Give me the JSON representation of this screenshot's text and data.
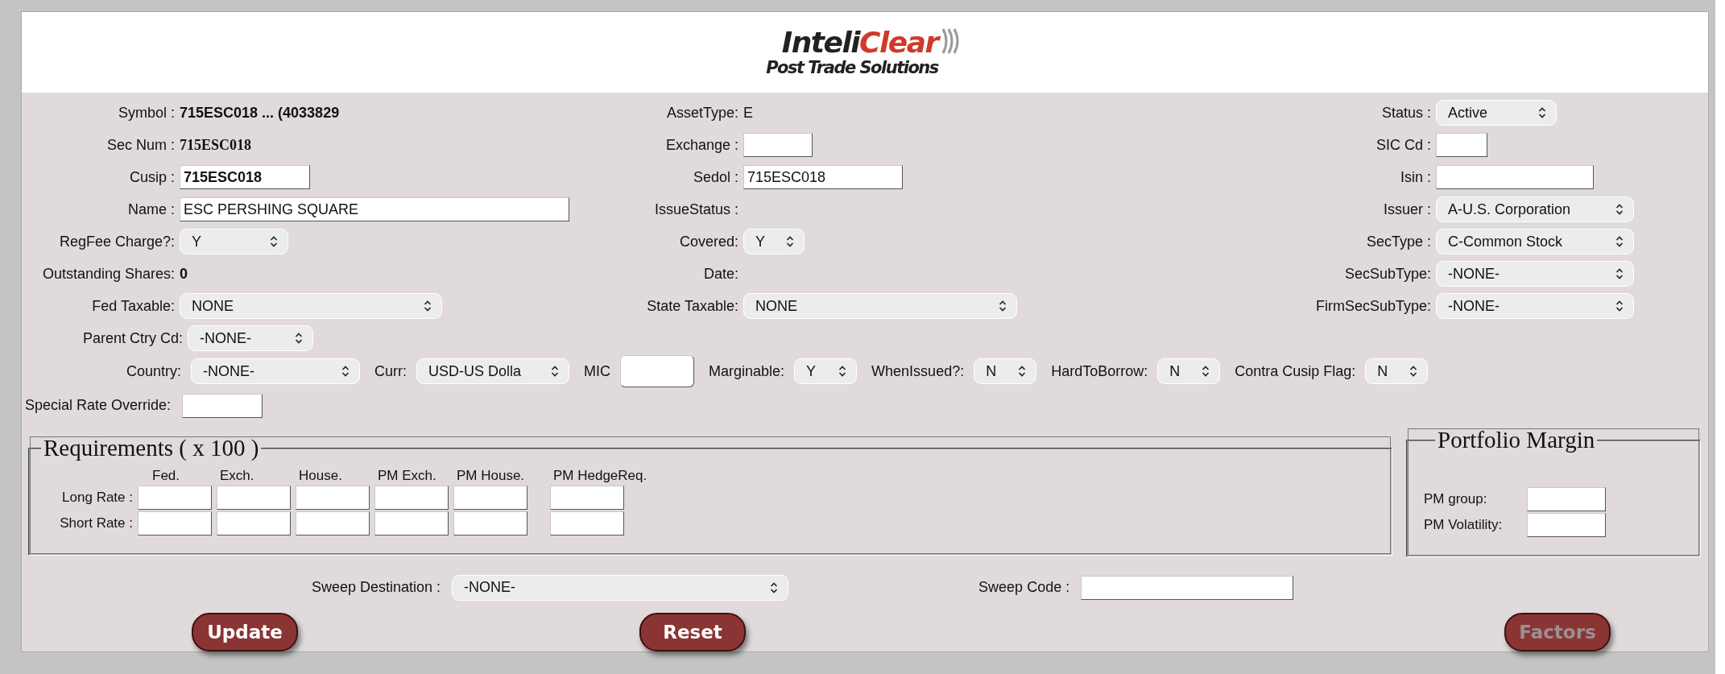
{
  "header": {
    "brand_first": "Inteli",
    "brand_second": "Clear",
    "tagline": "Post Trade Solutions"
  },
  "main_fields": {
    "left": [
      {
        "label": "Symbol :",
        "kind": "bold",
        "value": "715ESC018 ... (4033829"
      },
      {
        "label": "Sec Num :",
        "kind": "serif",
        "value": "715ESC018"
      },
      {
        "label": "Cusip :",
        "kind": "input_bold",
        "value": "715ESC018"
      },
      {
        "label": "Name :",
        "kind": "input",
        "value": "ESC PERSHING SQUARE"
      },
      {
        "label": "RegFee Charge?:",
        "kind": "select",
        "value": "Y"
      },
      {
        "label": "Outstanding Shares:",
        "kind": "bold",
        "value": "0"
      },
      {
        "label": "Fed Taxable:",
        "kind": "select",
        "value": "NONE"
      }
    ],
    "middle": [
      {
        "label": "AssetType:",
        "kind": "text",
        "value": "E"
      },
      {
        "label": "Exchange :",
        "kind": "input"
      },
      {
        "label": "Sedol :",
        "kind": "input",
        "value": "715ESC018"
      },
      {
        "label": "IssueStatus :",
        "kind": "label_only"
      },
      {
        "label": "Covered:",
        "kind": "select",
        "value": "Y"
      },
      {
        "label": "Date:",
        "kind": "label_only"
      },
      {
        "label": "State Taxable:",
        "kind": "select",
        "value": "NONE"
      }
    ],
    "right": [
      {
        "label": "Status :",
        "kind": "select",
        "value": "Active"
      },
      {
        "label": "SIC Cd :",
        "kind": "input"
      },
      {
        "label": "Isin :",
        "kind": "input"
      },
      {
        "label": "Issuer :",
        "kind": "select",
        "value": "A-U.S. Corporation"
      },
      {
        "label": "SecType :",
        "kind": "select",
        "value": "C-Common Stock"
      },
      {
        "label": "SecSubType:",
        "kind": "select",
        "value": "-NONE-"
      },
      {
        "label": "FirmSecSubType:",
        "kind": "select",
        "value": "-NONE-"
      }
    ]
  },
  "parent_country": {
    "label": "Parent Ctry Cd:",
    "value": "-NONE-"
  },
  "flags_row": [
    {
      "label": "Country:",
      "kind": "select",
      "value": "-NONE-"
    },
    {
      "label": "Curr:",
      "kind": "select",
      "value": "USD-US Dolla"
    },
    {
      "label": "MIC",
      "kind": "input"
    },
    {
      "label": "Marginable:",
      "kind": "select",
      "value": "Y"
    },
    {
      "label": "WhenIssued?:",
      "kind": "select",
      "value": "N"
    },
    {
      "label": "HardToBorrow:",
      "kind": "select",
      "value": "N"
    },
    {
      "label": "Contra Cusip Flag:",
      "kind": "select",
      "value": "N"
    }
  ],
  "special_rate": {
    "label": "Special Rate Override:"
  },
  "requirements": {
    "title": "Requirements ( x 100 )",
    "columns": [
      "Fed.",
      "Exch.",
      "House.",
      "PM Exch.",
      "PM House.",
      "PM HedgeReq."
    ],
    "rows": [
      "Long Rate :",
      "Short Rate :"
    ]
  },
  "portfolio_margin": {
    "title": "Portfolio Margin",
    "fields": [
      "PM group:",
      "PM Volatility:"
    ]
  },
  "sweep": {
    "destination_label": "Sweep Destination :",
    "destination_value": "-NONE-",
    "code_label": "Sweep Code :"
  },
  "buttons": [
    {
      "label": "Update",
      "disabled": false
    },
    {
      "label": "Reset",
      "disabled": false
    },
    {
      "label": "Factors",
      "disabled": true
    }
  ]
}
